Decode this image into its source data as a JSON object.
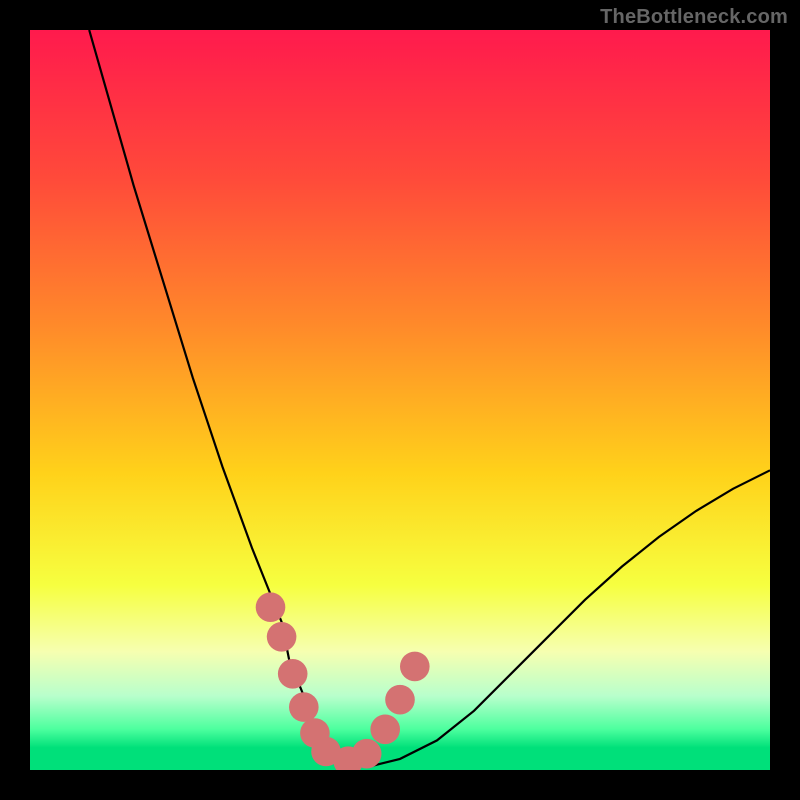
{
  "watermark": "TheBottleneck.com",
  "chart_data": {
    "type": "line",
    "title": "",
    "xlabel": "",
    "ylabel": "",
    "xlim": [
      0,
      100
    ],
    "ylim": [
      0,
      100
    ],
    "grid": false,
    "legend": false,
    "gradient_stops": [
      {
        "offset": 0,
        "color": "#ff1a4d"
      },
      {
        "offset": 0.2,
        "color": "#ff4a3a"
      },
      {
        "offset": 0.4,
        "color": "#ff8a2a"
      },
      {
        "offset": 0.6,
        "color": "#ffd21a"
      },
      {
        "offset": 0.75,
        "color": "#f6ff40"
      },
      {
        "offset": 0.84,
        "color": "#f6ffb0"
      },
      {
        "offset": 0.9,
        "color": "#b8ffcc"
      },
      {
        "offset": 0.945,
        "color": "#4cff9e"
      },
      {
        "offset": 0.97,
        "color": "#00e07a"
      },
      {
        "offset": 1.0,
        "color": "#00e07a"
      }
    ],
    "series": [
      {
        "name": "curve",
        "stroke": "#000000",
        "x": [
          8,
          10,
          12,
          14,
          16,
          18,
          20,
          22,
          24,
          26,
          28,
          30,
          32,
          34,
          35,
          37,
          38.5,
          40,
          41.5,
          43.5,
          46,
          50,
          55,
          60,
          65,
          70,
          75,
          80,
          85,
          90,
          95,
          100
        ],
        "y": [
          100,
          93,
          86,
          79,
          72.5,
          66,
          59.5,
          53,
          47,
          41,
          35.5,
          30,
          25,
          20,
          15,
          10,
          6,
          3,
          1.2,
          0.5,
          0.5,
          1.5,
          4,
          8,
          13,
          18,
          23,
          27.5,
          31.5,
          35,
          38,
          40.5
        ]
      }
    ],
    "markers": {
      "name": "sample-points",
      "fill": "#d47272",
      "radius": 2.0,
      "x": [
        32.5,
        34,
        35.5,
        37,
        38.5,
        40,
        43,
        45.5,
        48,
        50,
        52
      ],
      "y": [
        22,
        18,
        13,
        8.5,
        5,
        2.5,
        1.2,
        2.2,
        5.5,
        9.5,
        14
      ]
    }
  }
}
